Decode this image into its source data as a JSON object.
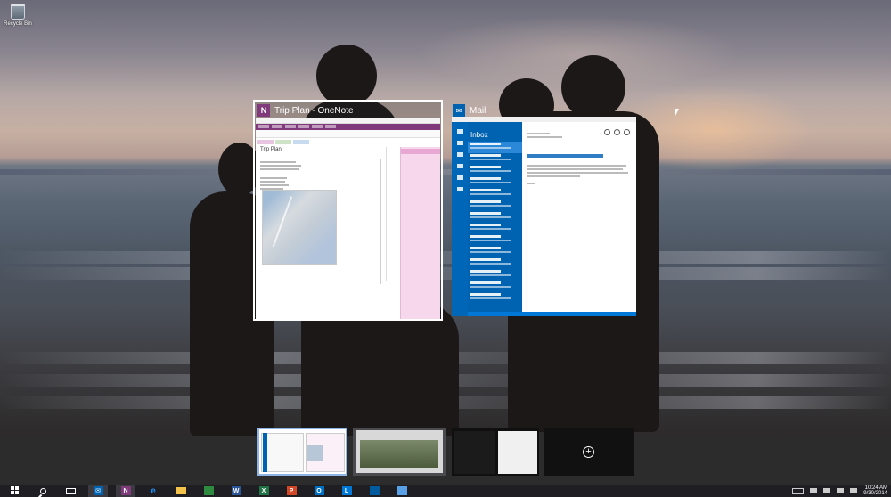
{
  "desktop": {
    "recycle_bin_label": "Recycle Bin"
  },
  "windows": [
    {
      "app": "OneNote",
      "title": "Trip Plan - OneNote",
      "icon": "onenote-icon",
      "accent": "#80397b",
      "badge": "N",
      "page_title": "Trip Plan"
    },
    {
      "app": "Mail",
      "title": "Mail",
      "icon": "mail-icon",
      "accent": "#0063b1",
      "inbox_label": "Inbox"
    }
  ],
  "task_view": {
    "desktops": [
      "desktop-1",
      "desktop-2",
      "desktop-3"
    ],
    "add_desktop_glyph": "+"
  },
  "taskbar": {
    "items": [
      {
        "name": "start-icon"
      },
      {
        "name": "search-icon"
      },
      {
        "name": "task-view-icon"
      },
      {
        "name": "mail-icon",
        "letter": ""
      },
      {
        "name": "onenote-icon",
        "letter": "N",
        "color": "#80397b"
      },
      {
        "name": "internet-explorer-icon",
        "letter": "e",
        "color": "#1e90ff"
      },
      {
        "name": "file-explorer-icon",
        "letter": "",
        "color": "#f2c24b"
      },
      {
        "name": "store-icon",
        "letter": "",
        "color": "#2d8a3e"
      },
      {
        "name": "word-icon",
        "letter": "W",
        "color": "#2b579a"
      },
      {
        "name": "excel-icon",
        "letter": "X",
        "color": "#217346"
      },
      {
        "name": "powerpoint-icon",
        "letter": "P",
        "color": "#d24726"
      },
      {
        "name": "outlook-icon",
        "letter": "O",
        "color": "#0072c6"
      },
      {
        "name": "lync-icon",
        "letter": "L",
        "color": "#0078d7"
      },
      {
        "name": "app-icon",
        "letter": "",
        "color": "#005a9e"
      },
      {
        "name": "photos-icon",
        "letter": "",
        "color": "#5aa0e6"
      }
    ],
    "tray": {
      "time": "10:24 AM",
      "date": "9/30/2014"
    }
  }
}
